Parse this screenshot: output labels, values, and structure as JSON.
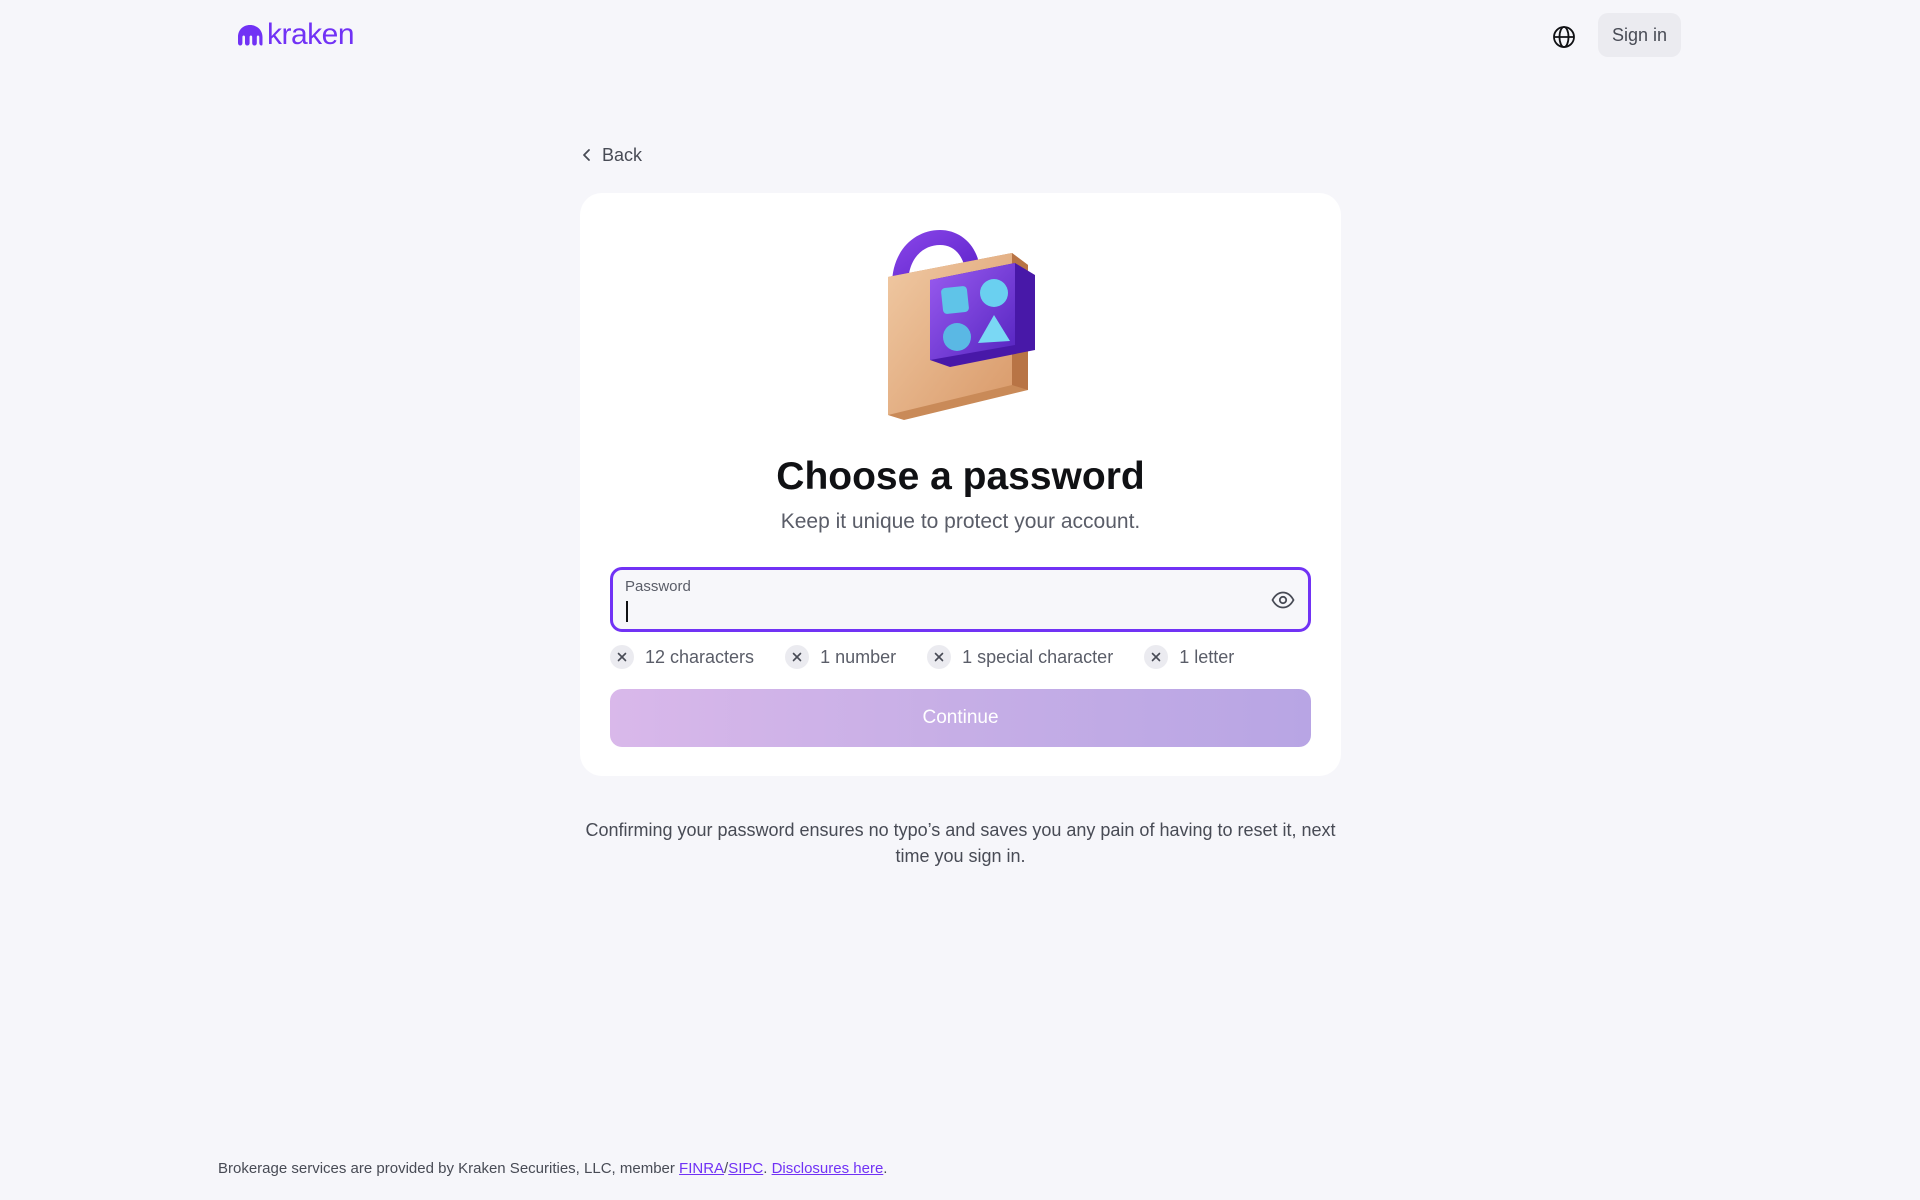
{
  "header": {
    "logo_text": "kraken",
    "signin_label": "Sign in",
    "language_icon": "globe-icon"
  },
  "nav": {
    "back_label": "Back"
  },
  "card": {
    "title": "Choose a password",
    "subtitle": "Keep it unique to protect your account.",
    "password_field": {
      "label": "Password",
      "value": "",
      "toggle_icon": "eye-icon"
    },
    "requirements": [
      {
        "label": "12 characters",
        "met": false
      },
      {
        "label": "1 number",
        "met": false
      },
      {
        "label": "1 special character",
        "met": false
      },
      {
        "label": "1 letter",
        "met": false
      }
    ],
    "continue_label": "Continue"
  },
  "note": "Confirming your password ensures no typo’s and saves you any pain of having to reset it, next time you sign in.",
  "footer": {
    "text_before": "Brokerage services are provided by Kraken Securities, LLC, member ",
    "finra": "FINRA",
    "slash": "/",
    "sipc": "SIPC",
    "dot": ". ",
    "disclosures": "Disclosures here",
    "end": "."
  },
  "colors": {
    "brand": "#7132f5",
    "background": "#f6f6fa",
    "card": "#ffffff"
  }
}
